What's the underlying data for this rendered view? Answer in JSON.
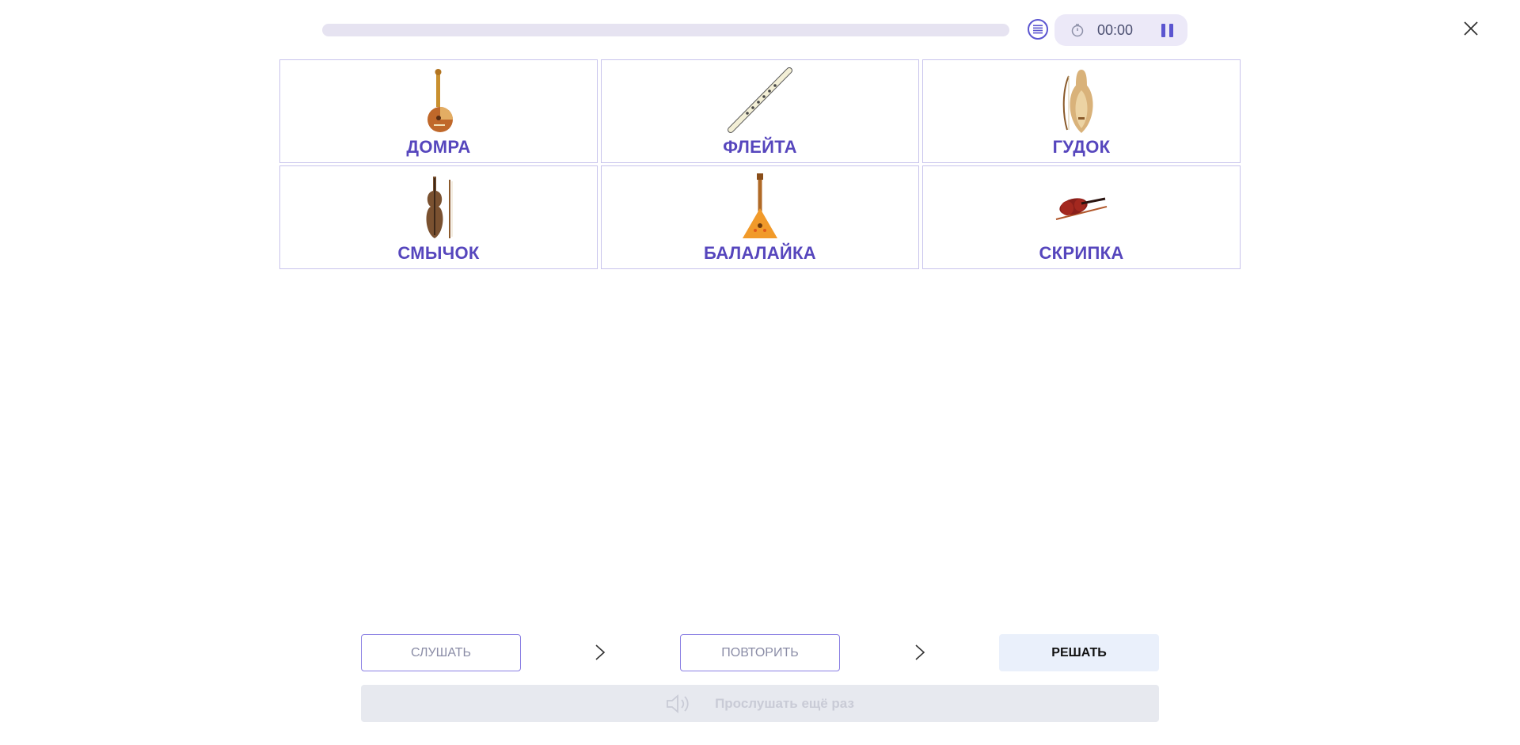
{
  "header": {
    "progress": 0,
    "timer": "00:00",
    "list_icon": "list-icon",
    "clock_icon": "stopwatch-icon",
    "pause_icon": "pause-icon",
    "close_icon": "close-icon"
  },
  "cards": [
    {
      "label": "ДОМРА",
      "icon": "domra-image"
    },
    {
      "label": "ФЛЕЙТА",
      "icon": "flute-image"
    },
    {
      "label": "ГУДОК",
      "icon": "gudok-image"
    },
    {
      "label": "СМЫЧОК",
      "icon": "bow-image"
    },
    {
      "label": "БАЛАЛАЙКА",
      "icon": "balalaika-image"
    },
    {
      "label": "СКРИПКА",
      "icon": "violin-image"
    }
  ],
  "steps": {
    "listen": "СЛУШАТЬ",
    "repeat": "ПОВТОРИТЬ",
    "solve": "РЕШАТЬ",
    "replay": "Прослушать ещё раз"
  },
  "colors": {
    "accent": "#5646bd",
    "card_border": "#c8c4ec",
    "timer_bg": "#ece9f8",
    "track": "#e6e3f1"
  }
}
